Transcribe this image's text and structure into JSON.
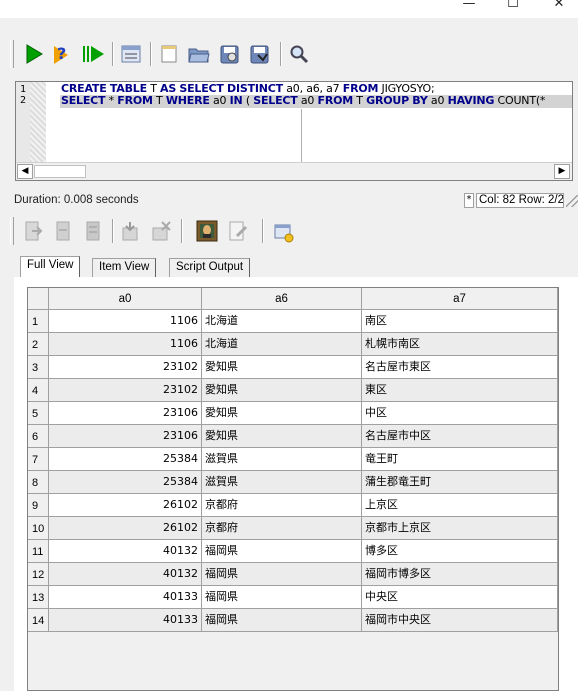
{
  "window": {
    "minimize": "—",
    "maximize": "☐",
    "close": "✕"
  },
  "editor": {
    "line_numbers": [
      "1",
      "2"
    ],
    "line1": [
      {
        "t": "CREATE",
        "k": 1
      },
      {
        "t": " ",
        "k": 0
      },
      {
        "t": "TABLE",
        "k": 1
      },
      {
        "t": " T ",
        "k": 0
      },
      {
        "t": "AS",
        "k": 1
      },
      {
        "t": " ",
        "k": 0
      },
      {
        "t": "SELECT",
        "k": 1
      },
      {
        "t": " ",
        "k": 0
      },
      {
        "t": "DISTINCT",
        "k": 1
      },
      {
        "t": " a0, a6, a7 ",
        "k": 0
      },
      {
        "t": "FROM",
        "k": 1
      },
      {
        "t": " JIGYOSYO;",
        "k": 0
      }
    ],
    "line2": [
      {
        "t": "SELECT",
        "k": 1
      },
      {
        "t": " * ",
        "k": 0
      },
      {
        "t": "FROM",
        "k": 1
      },
      {
        "t": " T ",
        "k": 0
      },
      {
        "t": "WHERE",
        "k": 1
      },
      {
        "t": " a0 ",
        "k": 0
      },
      {
        "t": "IN",
        "k": 1
      },
      {
        "t": " ( ",
        "k": 0
      },
      {
        "t": "SELECT",
        "k": 1
      },
      {
        "t": " a0 ",
        "k": 0
      },
      {
        "t": "FROM",
        "k": 1
      },
      {
        "t": " T ",
        "k": 0
      },
      {
        "t": "GROUP",
        "k": 1
      },
      {
        "t": " ",
        "k": 0
      },
      {
        "t": "BY",
        "k": 1
      },
      {
        "t": " a0 ",
        "k": 0
      },
      {
        "t": "HAVING",
        "k": 1
      },
      {
        "t": " COUNT(*",
        "k": 0
      }
    ],
    "scroll_left": "◀",
    "scroll_right": "▶"
  },
  "status": {
    "duration": "Duration: 0.008 seconds",
    "modified": "*",
    "position": "Col: 82 Row: 2/2"
  },
  "tabs": [
    "Full View",
    "Item View",
    "Script Output"
  ],
  "active_tab": 0,
  "grid": {
    "columns": [
      "a0",
      "a6",
      "a7"
    ],
    "rows": [
      [
        "1",
        "1106",
        "北海道",
        "南区"
      ],
      [
        "2",
        "1106",
        "北海道",
        "札幌市南区"
      ],
      [
        "3",
        "23102",
        "愛知県",
        "名古屋市東区"
      ],
      [
        "4",
        "23102",
        "愛知県",
        "東区"
      ],
      [
        "5",
        "23106",
        "愛知県",
        "中区"
      ],
      [
        "6",
        "23106",
        "愛知県",
        "名古屋市中区"
      ],
      [
        "7",
        "25384",
        "滋賀県",
        "竜王町"
      ],
      [
        "8",
        "25384",
        "滋賀県",
        "蒲生郡竜王町"
      ],
      [
        "9",
        "26102",
        "京都府",
        "上京区"
      ],
      [
        "10",
        "26102",
        "京都府",
        "京都市上京区"
      ],
      [
        "11",
        "40132",
        "福岡県",
        "博多区"
      ],
      [
        "12",
        "40132",
        "福岡県",
        "福岡市博多区"
      ],
      [
        "13",
        "40133",
        "福岡県",
        "中央区"
      ],
      [
        "14",
        "40133",
        "福岡県",
        "福岡市中央区"
      ]
    ]
  },
  "icons": {
    "toolbar1": [
      "run-icon",
      "run-help-icon",
      "step-run-icon",
      "results-grid-icon",
      "new-file-icon",
      "open-folder-icon",
      "save-icon",
      "save-as-icon",
      "find-icon"
    ],
    "toolbar2": [
      "export-icon",
      "commit-icon",
      "rollback-icon",
      "grid-options-icon",
      "delete-icon",
      "image-icon",
      "edit-icon",
      "query-builder-icon"
    ]
  },
  "colors": {
    "keyword": "#00008b",
    "run_green": "#00a000",
    "alt_row": "#ececec"
  }
}
